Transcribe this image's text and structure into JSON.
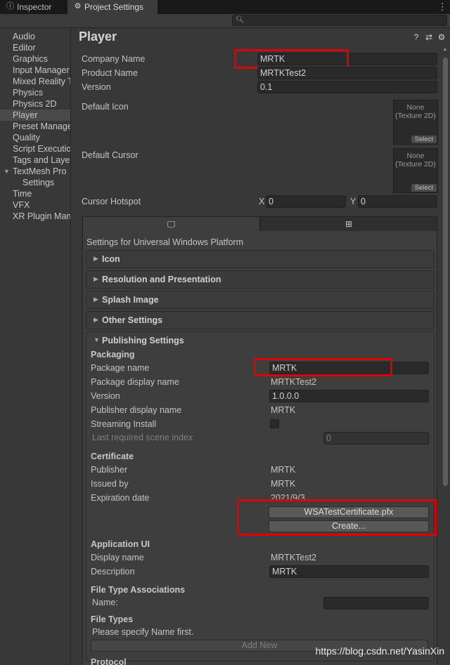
{
  "tabs": [
    {
      "label": "Inspector",
      "icon": "info-icon"
    },
    {
      "label": "Project Settings",
      "icon": "gear-icon"
    }
  ],
  "tab_menu_glyph": "⋮",
  "search": {
    "placeholder": "",
    "icon": "search-icon"
  },
  "sidebar": {
    "items": [
      {
        "label": "Audio"
      },
      {
        "label": "Editor"
      },
      {
        "label": "Graphics"
      },
      {
        "label": "Input Manager"
      },
      {
        "label": "Mixed Reality Toolkit"
      },
      {
        "label": "Physics"
      },
      {
        "label": "Physics 2D"
      },
      {
        "label": "Player"
      },
      {
        "label": "Preset Manager"
      },
      {
        "label": "Quality"
      },
      {
        "label": "Script Execution Order"
      },
      {
        "label": "Tags and Layers"
      },
      {
        "label": "TextMesh Pro"
      },
      {
        "label": "Settings"
      },
      {
        "label": "Time"
      },
      {
        "label": "VFX"
      },
      {
        "label": "XR Plugin Management"
      }
    ],
    "selected": "Player"
  },
  "header": {
    "title": "Player",
    "icons": [
      "help-icon",
      "preset-icon",
      "settings-icon"
    ]
  },
  "player": {
    "company_name_label": "Company Name",
    "company_name": "MRTK",
    "product_name_label": "Product Name",
    "product_name": "MRTKTest2",
    "version_label": "Version",
    "version": "0.1",
    "default_icon_label": "Default Icon",
    "default_cursor_label": "Default Cursor",
    "texture_none": "None",
    "texture_type": "(Texture 2D)",
    "select_label": "Select",
    "cursor_hotspot_label": "Cursor Hotspot",
    "x_label": "X",
    "x_value": "0",
    "y_label": "Y",
    "y_value": "0"
  },
  "platform": {
    "tabs": [
      {
        "icon": "monitor-icon"
      },
      {
        "icon": "windows-icon"
      }
    ],
    "heading": "Settings for Universal Windows Platform",
    "sections": [
      {
        "label": "Icon"
      },
      {
        "label": "Resolution and Presentation"
      },
      {
        "label": "Splash Image"
      },
      {
        "label": "Other Settings"
      }
    ],
    "publishing": {
      "label": "Publishing Settings",
      "packaging": "Packaging",
      "package_name_label": "Package name",
      "package_name": "MRTK",
      "package_display_name_label": "Package display name",
      "package_display_name": "MRTKTest2",
      "version_label": "Version",
      "version": "1.0.0.0",
      "publisher_display_name_label": "Publisher display name",
      "publisher_display_name": "MRTK",
      "streaming_install_label": "Streaming Install",
      "last_scene_label": "Last required scene index",
      "last_scene_value": "0",
      "certificate": "Certificate",
      "publisher_label": "Publisher",
      "publisher": "MRTK",
      "issued_by_label": "Issued by",
      "issued_by": "MRTK",
      "expiration_label": "Expiration date",
      "expiration": "2021/9/3",
      "cert_file_button": "WSATestCertificate.pfx",
      "create_button": "Create...",
      "application_ui": "Application UI",
      "display_name_label": "Display name",
      "display_name": "MRTKTest2",
      "description_label": "Description",
      "description": "MRTK",
      "file_type_assoc": "File Type Associations",
      "name_label": "Name:",
      "name_value": "",
      "file_types": "File Types",
      "specify_name": "Please specify Name first.",
      "add_new_button": "Add New",
      "protocol": "Protocol"
    }
  },
  "watermark": "https://blog.csdn.net/YasinXin",
  "colors": {
    "highlight": "#e00000",
    "background": "#383838"
  }
}
